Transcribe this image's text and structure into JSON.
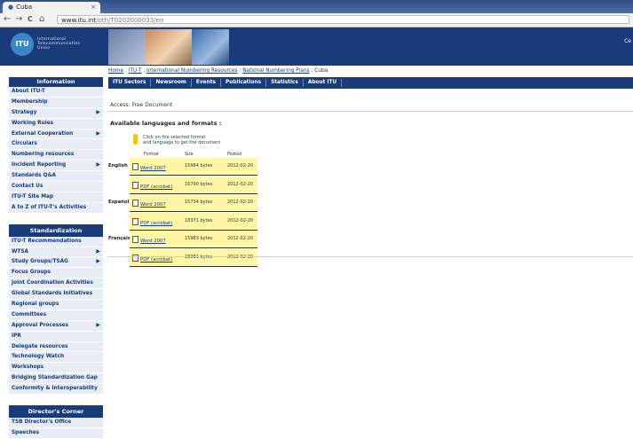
{
  "browser": {
    "tab_title": "Cuba",
    "tab_close": "×",
    "url_host": "www.itu.int",
    "url_path": "/oth/T0202000033/en",
    "back": "←",
    "forward": "→",
    "reload": "C",
    "home": "⌂"
  },
  "header": {
    "logo_text": "ITU",
    "org_name_lines": [
      "International",
      "Telecommunication",
      "Union"
    ],
    "corner_text": "Ce"
  },
  "breadcrumb": {
    "home": "Home",
    "itut": "ITU-T",
    "inr": "International Numbering Resources",
    "nnp": "National Numbering Plans",
    "current": "Cuba",
    "sep": " : "
  },
  "topnav": [
    "ITU Sectors",
    "Newsroom",
    "Events",
    "Publications",
    "Statistics",
    "About ITU"
  ],
  "sidebar": {
    "section1_title": "Information",
    "section1_items": [
      {
        "label": "About ITU-T",
        "arrow": false
      },
      {
        "label": "Membership",
        "arrow": false
      },
      {
        "label": "Strategy",
        "arrow": true
      },
      {
        "label": "Working Rules",
        "arrow": false
      },
      {
        "label": "External Cooperation",
        "arrow": true
      },
      {
        "label": "Circulars",
        "arrow": false
      },
      {
        "label": "Numbering resources",
        "arrow": false
      },
      {
        "label": "Incident Reporting",
        "arrow": true
      },
      {
        "label": "Standards Q&A",
        "arrow": false
      },
      {
        "label": "Contact Us",
        "arrow": false
      },
      {
        "label": "ITU-T Site Map",
        "arrow": false
      },
      {
        "label": "A to Z of ITU-T's Activities",
        "arrow": false
      }
    ],
    "section2_title": "Standardization",
    "section2_items": [
      {
        "label": "ITU-T Recommendations",
        "arrow": false
      },
      {
        "label": "WTSA",
        "arrow": true
      },
      {
        "label": "Study Groups/TSAG",
        "arrow": true
      },
      {
        "label": "Focus Groups",
        "arrow": false
      },
      {
        "label": "Joint Coordination Activities",
        "arrow": false
      },
      {
        "label": "Global Standards Initiatives",
        "arrow": false
      },
      {
        "label": "Regional groups",
        "arrow": false
      },
      {
        "label": "Committees",
        "arrow": false
      },
      {
        "label": "Approval Processes",
        "arrow": true
      },
      {
        "label": "IPR",
        "arrow": false
      },
      {
        "label": "Delegate resources",
        "arrow": false
      },
      {
        "label": "Technology Watch",
        "arrow": false
      },
      {
        "label": "Workshops",
        "arrow": false
      },
      {
        "label": "Bridging Standardization Gap",
        "arrow": false
      },
      {
        "label": "Conformity & Interoperability",
        "arrow": false
      }
    ],
    "section3_title": "Director's Corner",
    "section3_items": [
      {
        "label": "TSB Director's Office",
        "arrow": false
      },
      {
        "label": "Speeches",
        "arrow": false
      }
    ]
  },
  "main": {
    "access": "Access: Free Document",
    "available": "Available languages and formats :",
    "hint_line1": "Click on the selected format",
    "hint_line2": "and language to get the document",
    "col_format": "Format",
    "col_size": "Size",
    "col_posted": "Posted",
    "rows": [
      {
        "lang": "English",
        "format": "Word 2007",
        "kind": "word",
        "size": "15984 bytes",
        "date": "2012-02-20"
      },
      {
        "lang": "",
        "format": "PDF (acrobat)",
        "kind": "pdf",
        "size": "16790 bytes",
        "date": "2012-02-20"
      },
      {
        "lang": "Español",
        "format": "Word 2007",
        "kind": "word",
        "size": "15734 bytes",
        "date": "2012-02-20"
      },
      {
        "lang": "",
        "format": "PDF (acrobat)",
        "kind": "pdf",
        "size": "18371 bytes",
        "date": "2012-02-20"
      },
      {
        "lang": "Français",
        "format": "Word 2007",
        "kind": "word",
        "size": "15983 bytes",
        "date": "2012-02-20"
      },
      {
        "lang": "",
        "format": "PDF (acrobat)",
        "kind": "pdf",
        "size": "18381 bytes",
        "date": "2012-02-20"
      }
    ]
  },
  "colors": {
    "navy": "#1a3b7a",
    "highlight": "#fef7a6"
  }
}
